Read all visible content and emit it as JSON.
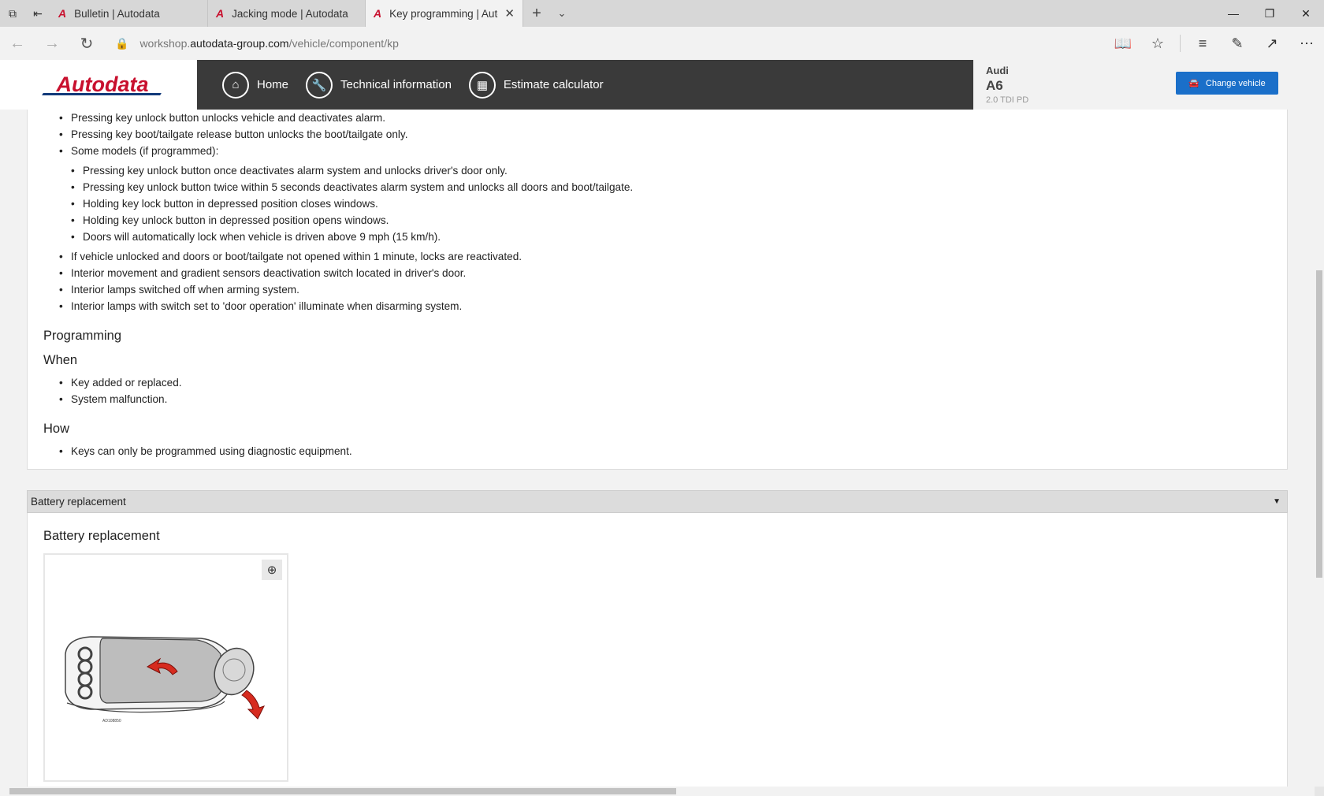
{
  "browser": {
    "tabs": [
      {
        "label": "Bulletin | Autodata"
      },
      {
        "label": "Jacking mode | Autodata"
      },
      {
        "label": "Key programming | Autodata"
      }
    ],
    "url_prefix": "workshop.",
    "url_domain": "autodata-group.com",
    "url_path": "/vehicle/component/kp",
    "tab_favicon": "A"
  },
  "header": {
    "logo": "Autodata",
    "nav": [
      {
        "label": "Home",
        "icon": "home-icon"
      },
      {
        "label": "Technical information",
        "icon": "wrench-icon"
      },
      {
        "label": "Estimate calculator",
        "icon": "calculator-icon"
      }
    ],
    "vehicle": {
      "make": "Audi",
      "model": "A6",
      "engine": "2.0 TDI PD"
    },
    "change_vehicle": "Change vehicle"
  },
  "content": {
    "list_top": [
      "Pressing key unlock button unlocks vehicle and deactivates alarm.",
      "Pressing key boot/tailgate release button unlocks the boot/tailgate only.",
      "Some models (if programmed):"
    ],
    "list_sub": [
      "Pressing key unlock button once deactivates alarm system and unlocks driver's door only.",
      "Pressing key unlock button twice within 5 seconds deactivates alarm system and unlocks all doors and boot/tailgate.",
      "Holding key lock button in depressed position closes windows.",
      "Holding key unlock button in depressed position opens windows.",
      "Doors will automatically lock when vehicle is driven above 9 mph (15 km/h)."
    ],
    "list_after": [
      "If vehicle unlocked and doors or boot/tailgate not opened within 1 minute, locks are reactivated.",
      "Interior movement and gradient sensors deactivation switch located in driver's door.",
      "Interior lamps switched off when arming system.",
      "Interior lamps with switch set to 'door operation' illuminate when disarming system."
    ],
    "programming_heading": "Programming",
    "when_heading": "When",
    "when_items": [
      "Key added or replaced.",
      "System malfunction."
    ],
    "how_heading": "How",
    "how_items": [
      "Keys can only be programmed using diagnostic equipment."
    ],
    "battery_section_label": "Battery replacement",
    "battery_heading": "Battery replacement",
    "figure_code": "AD108850"
  }
}
